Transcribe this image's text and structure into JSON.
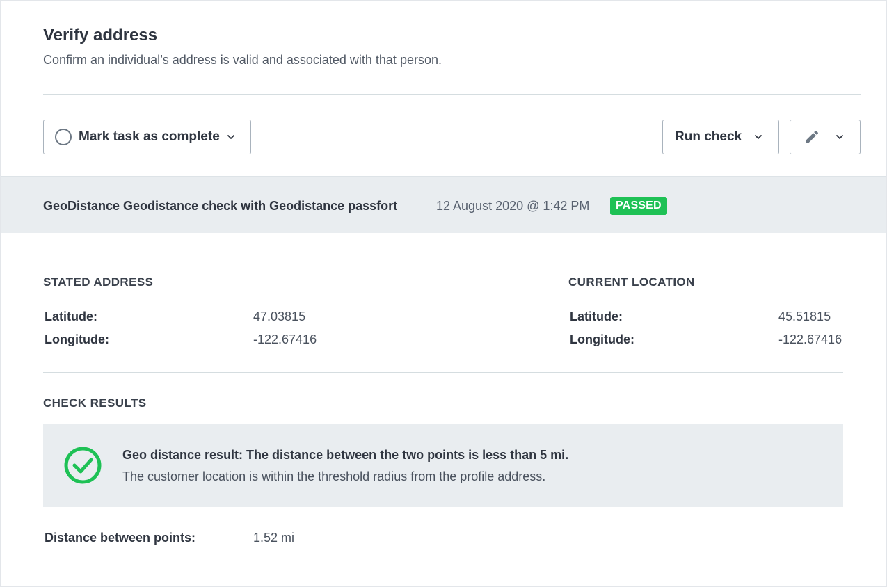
{
  "header": {
    "title": "Verify address",
    "subtitle": "Confirm an individual’s address is valid and associated with that person."
  },
  "toolbar": {
    "mark_complete_label": "Mark task as complete",
    "run_check_label": "Run check"
  },
  "check": {
    "name": "GeoDistance Geodistance check with Geodistance passfort",
    "date": "12 August 2020 @ 1:42 PM",
    "status": "PASSED",
    "status_color": "#1ec155"
  },
  "stated_address": {
    "heading": "STATED ADDRESS",
    "latitude_label": "Latitude:",
    "latitude": "47.03815",
    "longitude_label": "Longitude:",
    "longitude": "-122.67416"
  },
  "current_location": {
    "heading": "CURRENT LOCATION",
    "latitude_label": "Latitude:",
    "latitude": "45.51815",
    "longitude_label": "Longitude:",
    "longitude": "-122.67416"
  },
  "results": {
    "heading": "CHECK RESULTS",
    "title": "Geo distance result: The distance between the two points is less than 5 mi.",
    "description": "The customer location is within the threshold radius from the profile address.",
    "icon": "check-circle-icon",
    "icon_color": "#1ec155"
  },
  "distance": {
    "label": "Distance between points:",
    "value": "1.52 mi"
  }
}
